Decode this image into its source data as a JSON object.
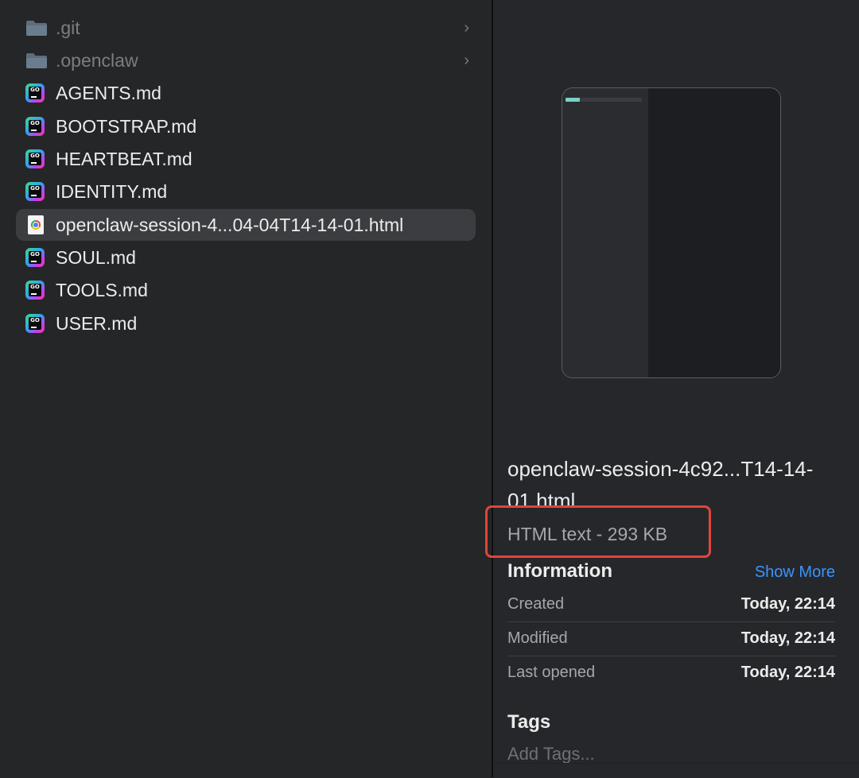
{
  "files": [
    {
      "name": ".git",
      "type": "folder"
    },
    {
      "name": ".openclaw",
      "type": "folder"
    },
    {
      "name": "AGENTS.md",
      "type": "go"
    },
    {
      "name": "BOOTSTRAP.md",
      "type": "go"
    },
    {
      "name": "HEARTBEAT.md",
      "type": "go"
    },
    {
      "name": "IDENTITY.md",
      "type": "go"
    },
    {
      "name": "openclaw-session-4...04-04T14-14-01.html",
      "type": "html",
      "selected": true
    },
    {
      "name": "SOUL.md",
      "type": "go"
    },
    {
      "name": "TOOLS.md",
      "type": "go"
    },
    {
      "name": "USER.md",
      "type": "go"
    }
  ],
  "icons": {
    "folder": "folder-icon",
    "go": "goland-file-icon",
    "html": "chrome-html-file-icon",
    "chevron": "chevron-right-icon",
    "chevron_glyph": "›",
    "go_badge": "GO"
  },
  "preview": {
    "title": "openclaw-session-4c92...T14-14-01.html",
    "kind": "HTML text - 293 KB",
    "information_label": "Information",
    "show_more": "Show More",
    "info": [
      {
        "label": "Created",
        "value": "Today, 22:14"
      },
      {
        "label": "Modified",
        "value": "Today, 22:14"
      },
      {
        "label": "Last opened",
        "value": "Today, 22:14"
      }
    ],
    "tags_label": "Tags",
    "add_tags": "Add Tags..."
  },
  "colors": {
    "accent_link": "#3b94ff",
    "highlight_border": "#e0463b",
    "selection_bg": "#3c3d40"
  }
}
